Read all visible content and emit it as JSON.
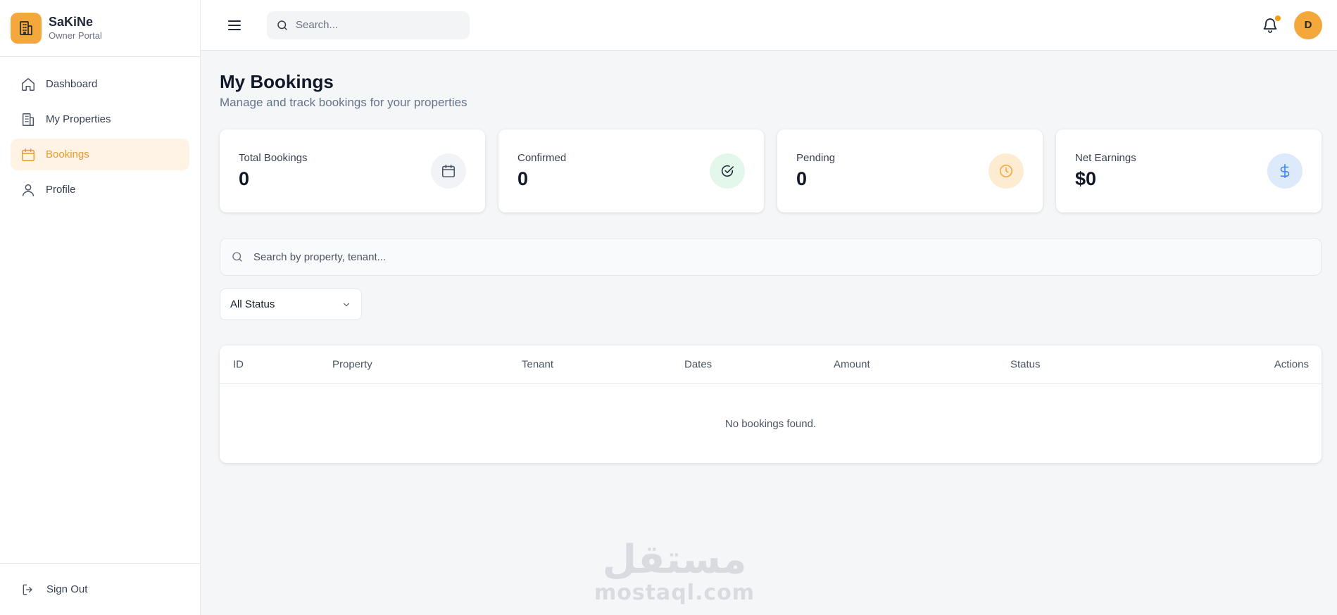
{
  "brand": {
    "name": "SaKiNe",
    "subtitle": "Owner Portal",
    "accent": "#f4a73b"
  },
  "sidebar": {
    "items": [
      {
        "label": "Dashboard",
        "icon": "home-icon",
        "active": false
      },
      {
        "label": "My Properties",
        "icon": "building-icon",
        "active": false
      },
      {
        "label": "Bookings",
        "icon": "calendar-icon",
        "active": true
      },
      {
        "label": "Profile",
        "icon": "user-icon",
        "active": false
      }
    ],
    "signout_label": "Sign Out"
  },
  "topbar": {
    "search_placeholder": "Search...",
    "avatar_initial": "D",
    "has_notification": true
  },
  "page": {
    "title": "My Bookings",
    "subtitle": "Manage and track bookings for your properties"
  },
  "stats": [
    {
      "label": "Total Bookings",
      "value": "0",
      "icon": "calendar-icon",
      "icon_bg": "#f1f3f6",
      "icon_color": "#4b5563"
    },
    {
      "label": "Confirmed",
      "value": "0",
      "icon": "check-circle-icon",
      "icon_bg": "#e3f7ea",
      "icon_color": "#22a35a"
    },
    {
      "label": "Pending",
      "value": "0",
      "icon": "clock-icon",
      "icon_bg": "#fdecd2",
      "icon_color": "#f4a73b"
    },
    {
      "label": "Net Earnings",
      "value": "$0",
      "icon": "dollar-icon",
      "icon_bg": "#ddeafc",
      "icon_color": "#3b82f6"
    }
  ],
  "filters": {
    "search_placeholder": "Search by property, tenant...",
    "status_selected": "All Status"
  },
  "table": {
    "columns": [
      "ID",
      "Property",
      "Tenant",
      "Dates",
      "Amount",
      "Status",
      "Actions"
    ],
    "empty_message": "No bookings found."
  },
  "watermark": {
    "arabic": "مستقل",
    "latin": "mostaql.com"
  }
}
